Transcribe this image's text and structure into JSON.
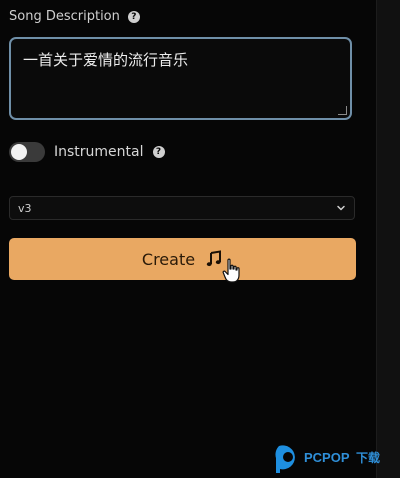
{
  "song_description": {
    "label": "Song Description",
    "value": "一首关于爱情的流行音乐"
  },
  "instrumental": {
    "label": "Instrumental",
    "enabled": false
  },
  "version_select": {
    "selected": "v3"
  },
  "create_button": {
    "label": "Create"
  },
  "icons": {
    "help": "help-icon",
    "note": "music-note-icon",
    "chevron": "chevron-down-icon",
    "cursor": "hand-cursor-icon"
  },
  "colors": {
    "button_bg": "#e9a862",
    "textarea_border": "#6f8fa8",
    "background": "#060606"
  }
}
